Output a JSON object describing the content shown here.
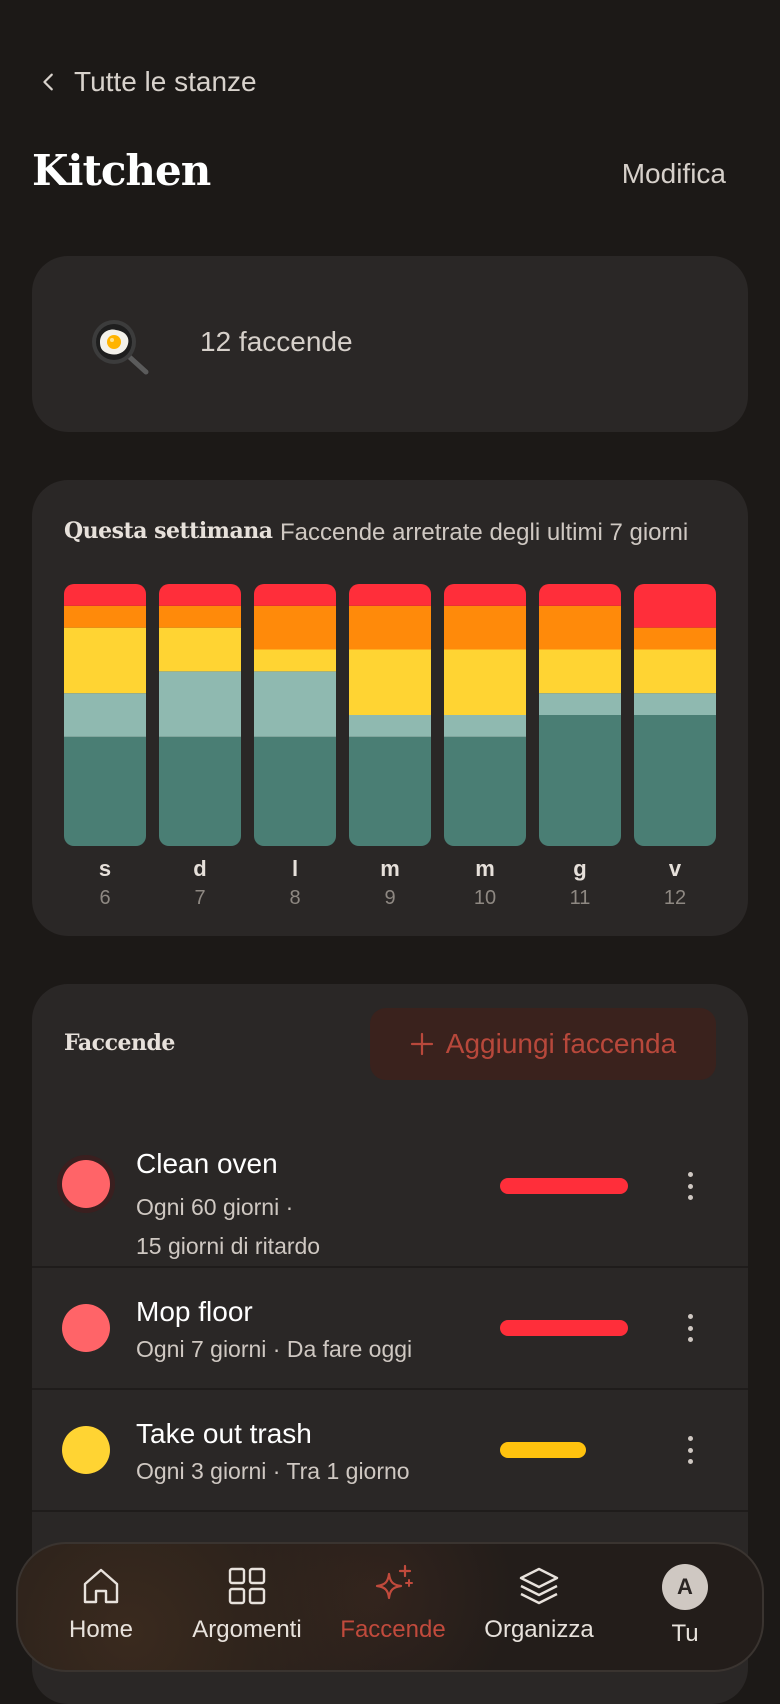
{
  "header": {
    "back_label": "Tutte le stanze",
    "title": "Kitchen",
    "edit_label": "Modifica"
  },
  "room": {
    "icon": "frying-pan-egg-icon",
    "count_label": "12 faccende"
  },
  "week": {
    "title": "Questa settimana",
    "subtitle": "Faccende arretrate degli ultimi 7 giorni"
  },
  "chart_data": {
    "type": "bar",
    "stacked": true,
    "categories": [
      "s",
      "d",
      "l",
      "m",
      "m",
      "g",
      "v"
    ],
    "dates": [
      "6",
      "7",
      "8",
      "9",
      "10",
      "11",
      "12"
    ],
    "colors": {
      "red": "#ff2e3a",
      "orange": "#ff8a0a",
      "yellow": "#ffd433",
      "mint": "#8fb9b0",
      "teal": "#4a7e74"
    },
    "series": [
      {
        "key": "teal",
        "values": [
          5,
          5,
          5,
          5,
          5,
          6,
          6
        ]
      },
      {
        "key": "mint",
        "values": [
          2,
          3,
          3,
          1,
          1,
          1,
          1
        ]
      },
      {
        "key": "yellow",
        "values": [
          3,
          2,
          1,
          3,
          3,
          2,
          2
        ]
      },
      {
        "key": "orange",
        "values": [
          1,
          1,
          2,
          2,
          2,
          2,
          1
        ]
      },
      {
        "key": "red",
        "values": [
          1,
          1,
          1,
          1,
          1,
          1,
          2
        ]
      }
    ],
    "ylim": [
      0,
      12
    ]
  },
  "chores": {
    "title": "Faccende",
    "add_label": "Aggiungi faccenda",
    "items": [
      {
        "name": "Clean oven",
        "meta1": "Ogni 60 giorni  ·",
        "meta2": "15 giorni di ritardo",
        "dot_color": "#ff6468",
        "bar_color": "#ff2e3a",
        "bar_fraction": 1.0
      },
      {
        "name": "Mop floor",
        "meta1": "Ogni 7 giorni  ·  Da fare oggi",
        "dot_color": "#ff6468",
        "bar_color": "#ff2e3a",
        "bar_fraction": 1.0
      },
      {
        "name": "Take out trash",
        "meta1": "Ogni 3 giorni  ·  Tra 1 giorno",
        "dot_color": "#ffd433",
        "bar_color": "#ffc20e",
        "bar_fraction": 0.67
      }
    ]
  },
  "nav": {
    "items": [
      {
        "label": "Home",
        "icon": "home-icon"
      },
      {
        "label": "Argomenti",
        "icon": "grid-icon"
      },
      {
        "label": "Faccende",
        "icon": "sparkle-icon",
        "active": true
      },
      {
        "label": "Organizza",
        "icon": "layers-icon"
      },
      {
        "label": "Tu",
        "icon": "avatar-icon",
        "initial": "A"
      }
    ]
  }
}
